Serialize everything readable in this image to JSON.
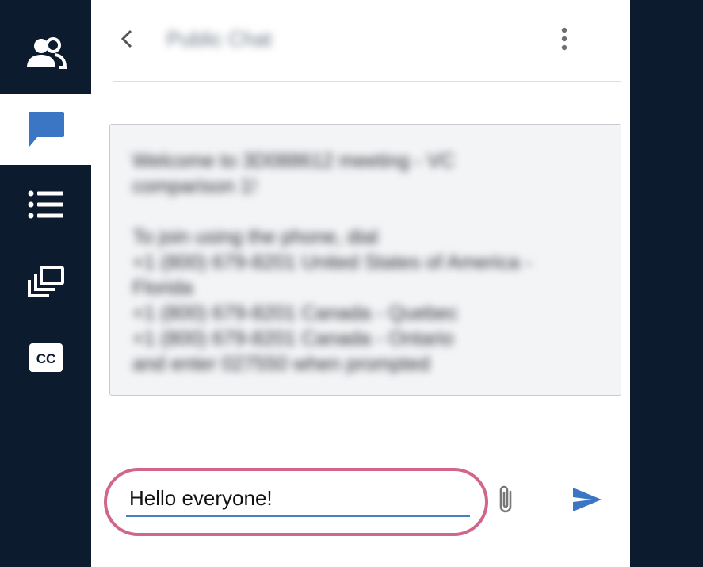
{
  "sidebar": {
    "items": [
      {
        "name": "users",
        "icon": "users-icon",
        "active": false
      },
      {
        "name": "chat",
        "icon": "chat-bubble-icon",
        "active": true
      },
      {
        "name": "list",
        "icon": "list-icon",
        "active": false
      },
      {
        "name": "breakout",
        "icon": "stacked-windows-icon",
        "active": false
      },
      {
        "name": "captions",
        "icon": "closed-captions-icon",
        "active": false
      }
    ]
  },
  "header": {
    "title": "Public Chat",
    "back_icon": "chevron-left-icon",
    "menu_icon": "more-vertical-icon"
  },
  "welcome": {
    "paragraphs": [
      [
        "Welcome to 3D088612 meeting - VC",
        "comparison 1!"
      ],
      [
        "To join using the phone, dial",
        "+1 (800) 679-8201 United States of America -",
        "Florida",
        "+1 (800) 679-8201 Canada - Quebec",
        "+1 (800) 679-8201 Canada - Ontario",
        "and enter 027550 when prompted"
      ]
    ]
  },
  "composer": {
    "value": "Hello everyone!",
    "attach_icon": "paperclip-icon",
    "send_icon": "send-icon"
  },
  "colors": {
    "rail_bg": "#0d1b2e",
    "accent": "#4a7fc1",
    "highlight_ring": "#d2668a"
  }
}
